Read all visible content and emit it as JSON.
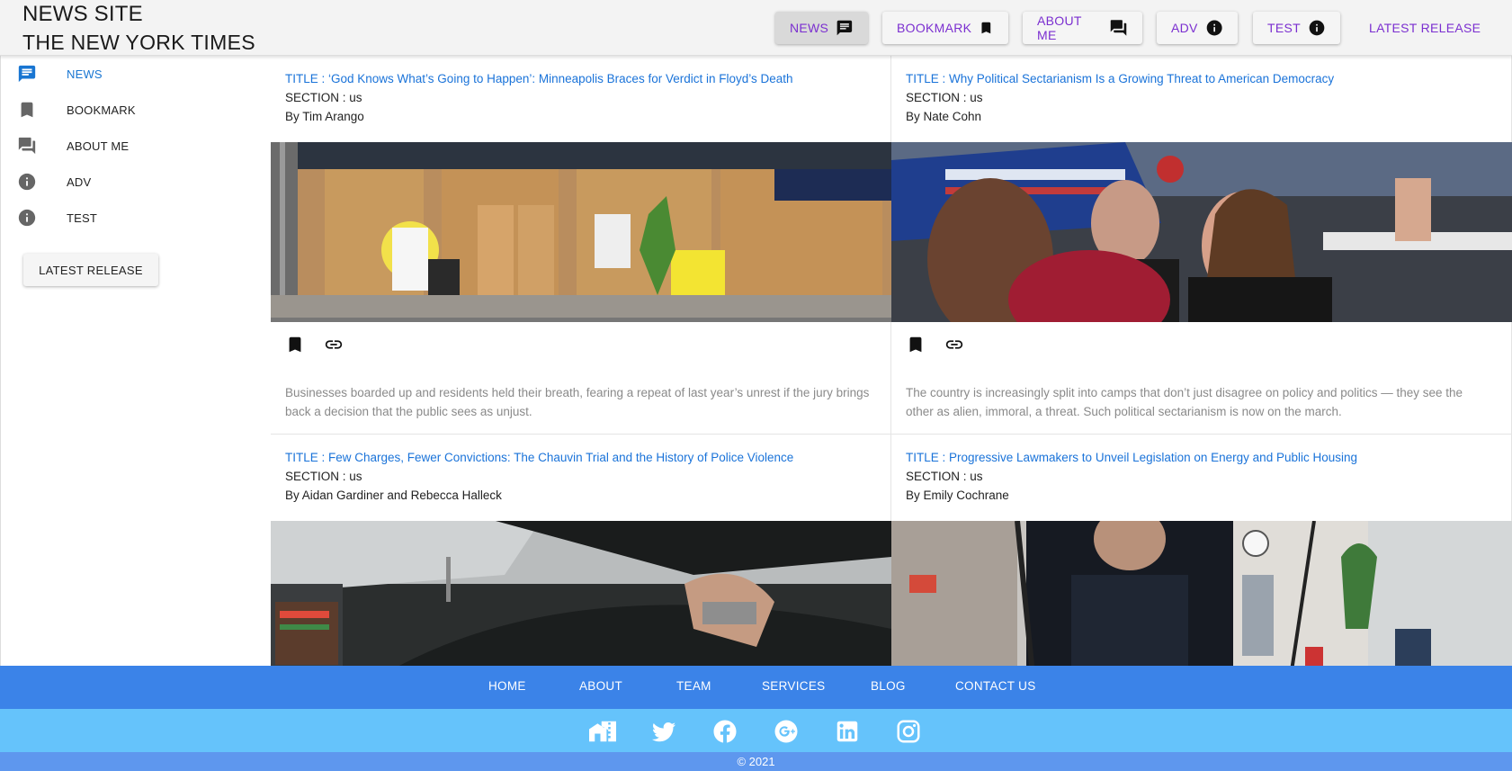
{
  "header": {
    "brand_line1": "NEWS SITE",
    "brand_line2": "THE NEW YORK TIMES",
    "nav": [
      {
        "label": "NEWS",
        "icon": "message-icon"
      },
      {
        "label": "BOOKMARK",
        "icon": "bookmark-icon"
      },
      {
        "label": "ABOUT ME",
        "icon": "forum-icon"
      },
      {
        "label": "ADV",
        "icon": "info-icon"
      },
      {
        "label": "TEST",
        "icon": "info-icon"
      },
      {
        "label": "LATEST RELEASE"
      }
    ]
  },
  "sidebar": {
    "items": [
      {
        "label": "NEWS",
        "icon": "message-icon"
      },
      {
        "label": "BOOKMARK",
        "icon": "bookmark-icon"
      },
      {
        "label": "ABOUT ME",
        "icon": "forum-icon"
      },
      {
        "label": "ADV",
        "icon": "info-icon"
      },
      {
        "label": "TEST",
        "icon": "info-icon"
      }
    ],
    "latest_release": "LATEST RELEASE"
  },
  "articles": [
    {
      "title": "TITLE : ‘God Knows What’s Going to Happen’: Minneapolis Braces for Verdict in Floyd’s Death",
      "section": "SECTION : us",
      "byline": "By Tim Arango",
      "snippet": "Businesses boarded up and residents held their breath, fearing a repeat of last year’s unrest if the jury brings back a decision that the public sees as unjust."
    },
    {
      "title": "TITLE : Why Political Sectarianism Is a Growing Threat to American Democracy",
      "section": "SECTION : us",
      "byline": "By Nate Cohn",
      "snippet": "The country is increasingly split into camps that don’t just disagree on policy and politics — they see the other as alien, immoral, a threat. Such political sectarianism is now on the march."
    },
    {
      "title": "TITLE : Few Charges, Fewer Convictions: The Chauvin Trial and the History of Police Violence",
      "section": "SECTION : us",
      "byline": "By Aidan Gardiner and Rebecca Halleck"
    },
    {
      "title": "TITLE : Progressive Lawmakers to Unveil Legislation on Energy and Public Housing",
      "section": "SECTION : us",
      "byline": "By Emily Cochrane"
    }
  ],
  "footer": {
    "links": [
      "HOME",
      "ABOUT",
      "TEAM",
      "SERVICES",
      "BLOG",
      "CONTACT US"
    ],
    "social": [
      "home-city-icon",
      "twitter-icon",
      "facebook-icon",
      "google-plus-icon",
      "linkedin-icon",
      "instagram-icon"
    ],
    "copyright": "© 2021"
  },
  "colors": {
    "accent_purple": "#7b2fd0",
    "link_blue": "#1a73d9",
    "footer_blue": "#3b83e8",
    "footer_light": "#65c3fb"
  }
}
